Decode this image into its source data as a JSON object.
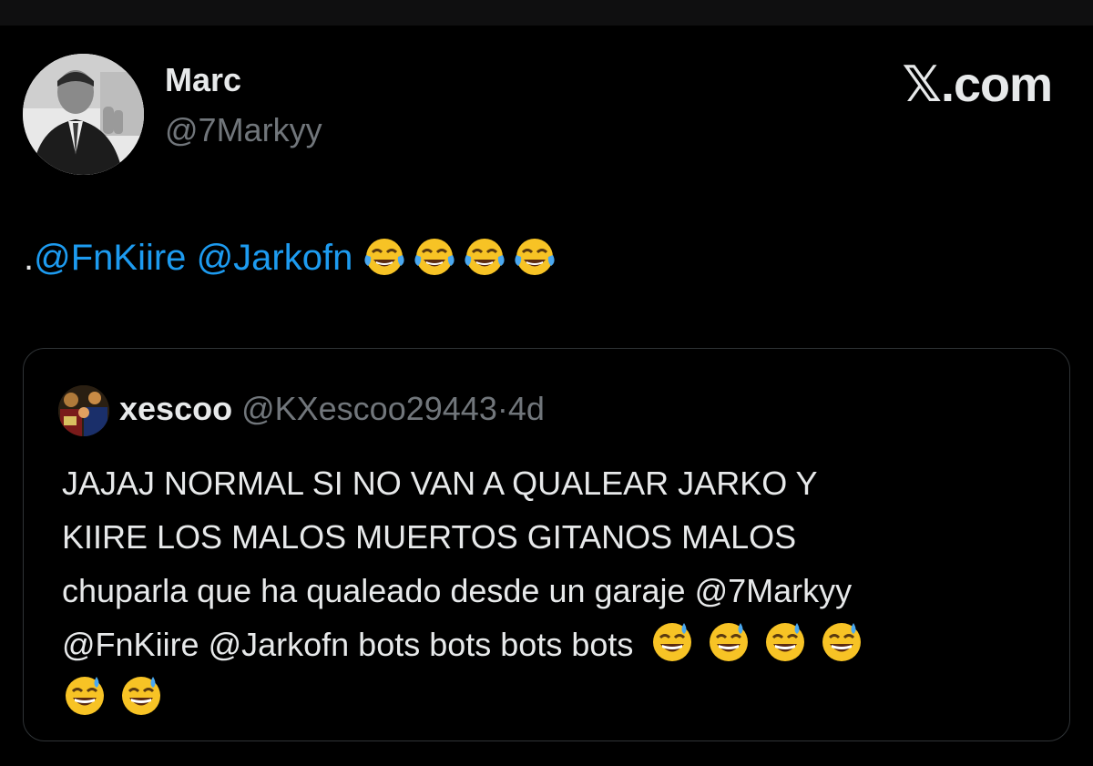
{
  "post": {
    "author_name": "Marc",
    "author_handle": "@7Markyy",
    "brand": "𝕏.com",
    "text_prefix": ".",
    "mention_1": "@FnKiire",
    "mention_2": "@Jarkofn",
    "emojis": [
      "face-with-tears-of-joy",
      "face-with-tears-of-joy",
      "face-with-tears-of-joy",
      "face-with-tears-of-joy"
    ]
  },
  "quote": {
    "name": "xescoo",
    "handle": "@KXescoo29443",
    "separator": "·",
    "time": "4d",
    "lines": [
      "JAJAJ NORMAL SI NO VAN A QUALEAR JARKO Y",
      "KIIRE LOS MALOS MUERTOS GITANOS MALOS",
      "chuparla que ha qualeado desde un garaje @7Markyy",
      "@FnKiire @Jarkofn bots bots bots bots"
    ],
    "emojis": [
      "grinning-face-with-sweat",
      "grinning-face-with-sweat",
      "grinning-face-with-sweat",
      "grinning-face-with-sweat",
      "grinning-face-with-sweat",
      "grinning-face-with-sweat"
    ]
  },
  "colors": {
    "background": "#000000",
    "text": "#e7e9ea",
    "secondary_text": "#71767b",
    "mention": "#1d9bf0",
    "border": "#2f3336"
  }
}
